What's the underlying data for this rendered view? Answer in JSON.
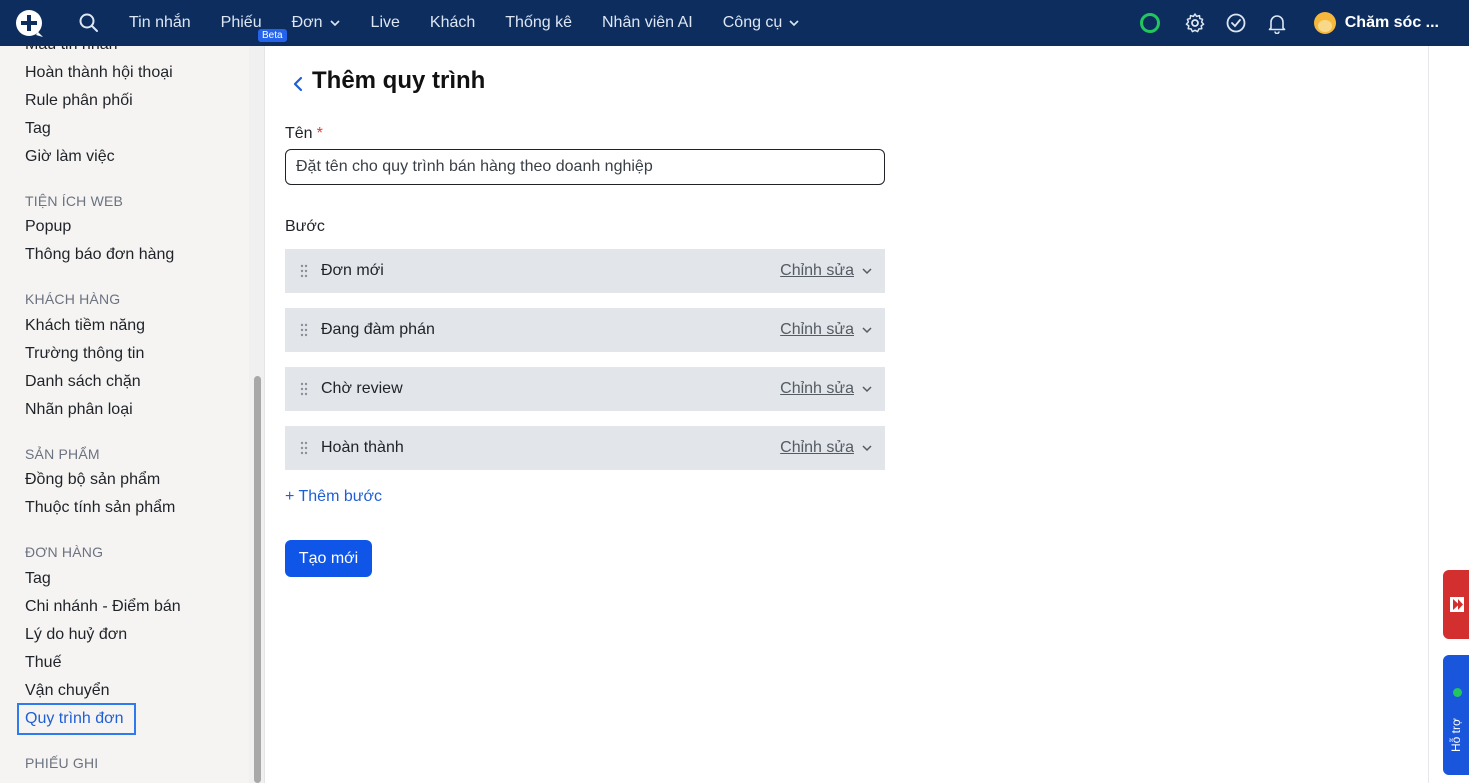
{
  "topbar": {
    "nav": [
      {
        "label": "Tin nhắn",
        "dropdown": false
      },
      {
        "label": "Phiếu",
        "dropdown": false,
        "badge": "Beta"
      },
      {
        "label": "Đơn",
        "dropdown": true
      },
      {
        "label": "Live",
        "dropdown": false
      },
      {
        "label": "Khách",
        "dropdown": false
      },
      {
        "label": "Thống kê",
        "dropdown": false
      },
      {
        "label": "Nhân viên AI",
        "dropdown": false
      },
      {
        "label": "Công cụ",
        "dropdown": true
      }
    ],
    "user_name": "Chăm sóc ...",
    "status_color": "#22c55e"
  },
  "sidebar": {
    "top_items": [
      "Mẫu tin nhắn",
      "Hoàn thành hội thoại",
      "Rule phân phối",
      "Tag",
      "Giờ làm việc"
    ],
    "sections": [
      {
        "title": "TIỆN ÍCH WEB",
        "items": [
          "Popup",
          "Thông báo đơn hàng"
        ]
      },
      {
        "title": "KHÁCH HÀNG",
        "items": [
          "Khách tiềm năng",
          "Trường thông tin",
          "Danh sách chặn",
          "Nhãn phân loại"
        ]
      },
      {
        "title": "SẢN PHẨM",
        "items": [
          "Đồng bộ sản phẩm",
          "Thuộc tính sản phẩm"
        ]
      },
      {
        "title": "ĐƠN HÀNG",
        "items": [
          "Tag",
          "Chi nhánh - Điểm bán",
          "Lý do huỷ đơn",
          "Thuế",
          "Vận chuyển",
          "Quy trình đơn"
        ]
      },
      {
        "title": "PHIẾU GHI",
        "items": []
      }
    ],
    "active_item": "Quy trình đơn"
  },
  "form": {
    "title": "Thêm quy trình",
    "name_label": "Tên",
    "required_mark": "*",
    "name_placeholder": "Đặt tên cho quy trình bán hàng theo doanh nghiệp",
    "steps_label": "Bước",
    "steps": [
      {
        "name": "Đơn mới",
        "edit_label": "Chỉnh sửa"
      },
      {
        "name": "Đang đàm phán",
        "edit_label": "Chỉnh sửa"
      },
      {
        "name": "Chờ review",
        "edit_label": "Chỉnh sửa"
      },
      {
        "name": "Hoàn thành",
        "edit_label": "Chỉnh sửa"
      }
    ],
    "add_step_label": "+ Thêm bước",
    "submit_label": "Tạo mới"
  },
  "support_widget": {
    "label": "Hỗ trợ"
  },
  "colors": {
    "topbar": "#0c2d5e",
    "primary": "#0f55e8",
    "link": "#1f5fd6",
    "required": "#e53935"
  }
}
